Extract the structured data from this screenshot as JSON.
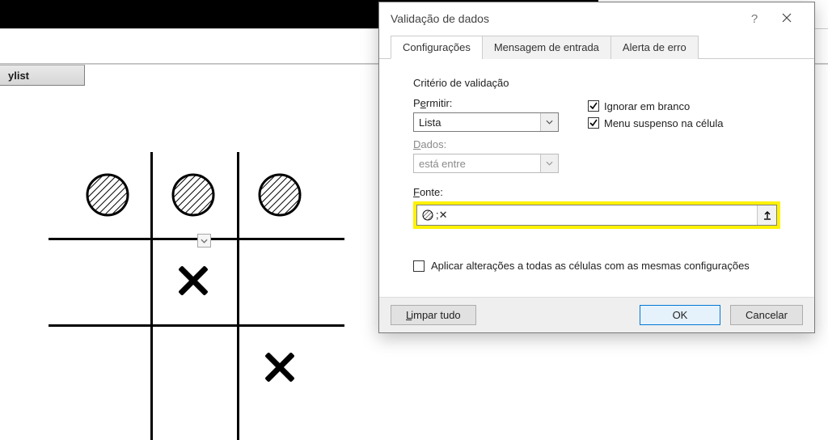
{
  "ribbon": {
    "ylist_label": "ylist"
  },
  "grid": {
    "cells": [
      [
        "O",
        "O",
        "O"
      ],
      [
        "",
        "X",
        ""
      ],
      [
        "",
        "",
        "X"
      ]
    ]
  },
  "dialog": {
    "title": "Validação de dados",
    "tabs": [
      "Configurações",
      "Mensagem de entrada",
      "Alerta de erro"
    ],
    "active_tab": 0,
    "criterion_legend": "Critério de validação",
    "allow_label_pre": "P",
    "allow_label_ul": "e",
    "allow_label_post": "rmitir:",
    "allow_value": "Lista",
    "data_label_pre": "",
    "data_label_ul": "D",
    "data_label_post": "ados:",
    "data_value": "está entre",
    "chk_ignore_pre": "Ignorar em ",
    "chk_ignore_ul": "b",
    "chk_ignore_post": "ranco",
    "chk_dropdown_pre": "Menu suspenso na ",
    "chk_dropdown_ul": "c",
    "chk_dropdown_post": "élula",
    "source_label_pre": "",
    "source_label_ul": "F",
    "source_label_post": "onte:",
    "source_value": ";✕",
    "apply_label_pre": "",
    "apply_label_ul": "A",
    "apply_label_post": "plicar alterações a todas as células com as mesmas configurações",
    "clear_label": "Limpar tudo",
    "ok_label": "OK",
    "cancel_label": "Cancelar"
  }
}
